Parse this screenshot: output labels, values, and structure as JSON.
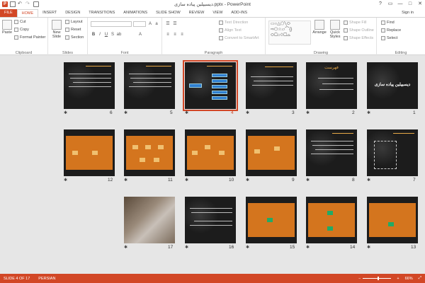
{
  "window": {
    "title": "دیسیپلین پیاده سازی.pptx - PowerPoint",
    "controls": [
      "?",
      "▭",
      "—",
      "□",
      "✕"
    ],
    "signin": "Sign in"
  },
  "tabs": [
    "FILE",
    "HOME",
    "INSERT",
    "DESIGN",
    "TRANSITIONS",
    "ANIMATIONS",
    "SLIDE SHOW",
    "REVIEW",
    "VIEW",
    "ADD-INS"
  ],
  "ribbon": {
    "clipboard": {
      "paste": "Paste",
      "cut": "Cut",
      "copy": "Copy",
      "format_painter": "Format Painter",
      "label": "Clipboard"
    },
    "slides": {
      "new_slide": "New Slide",
      "layout": "Layout",
      "reset": "Reset",
      "section": "Section",
      "label": "Slides"
    },
    "font": {
      "label": "Font"
    },
    "paragraph": {
      "text_direction": "Text Direction",
      "align_text": "Align Text",
      "convert": "Convert to SmartArt",
      "label": "Paragraph"
    },
    "drawing": {
      "arrange": "Arrange",
      "quick_styles": "Quick Styles",
      "shape_fill": "Shape Fill",
      "shape_outline": "Shape Outline",
      "shape_effects": "Shape Effects",
      "label": "Drawing"
    },
    "editing": {
      "find": "Find",
      "replace": "Replace",
      "select": "Select",
      "label": "Editing"
    }
  },
  "slides": [
    {
      "n": "1",
      "title": "دیسیپلین پیاده سازی"
    },
    {
      "n": "2",
      "title": "فهرست"
    },
    {
      "n": "3",
      "title": ""
    },
    {
      "n": "4",
      "title": ""
    },
    {
      "n": "5",
      "title": ""
    },
    {
      "n": "6",
      "title": ""
    },
    {
      "n": "7",
      "title": ""
    },
    {
      "n": "8",
      "title": ""
    },
    {
      "n": "9",
      "title": ""
    },
    {
      "n": "10",
      "title": ""
    },
    {
      "n": "11",
      "title": ""
    },
    {
      "n": "12",
      "title": ""
    },
    {
      "n": "13",
      "title": ""
    },
    {
      "n": "14",
      "title": ""
    },
    {
      "n": "15",
      "title": ""
    },
    {
      "n": "16",
      "title": ""
    },
    {
      "n": "17",
      "title": ""
    }
  ],
  "selected_slide": "4",
  "status": {
    "slide": "SLIDE 4 OF 17",
    "language": "PERSIAN",
    "zoom": "66%",
    "zoom_level": 0.55
  },
  "colors": {
    "accent": "#d24726",
    "orange_panel": "#d4751e"
  }
}
